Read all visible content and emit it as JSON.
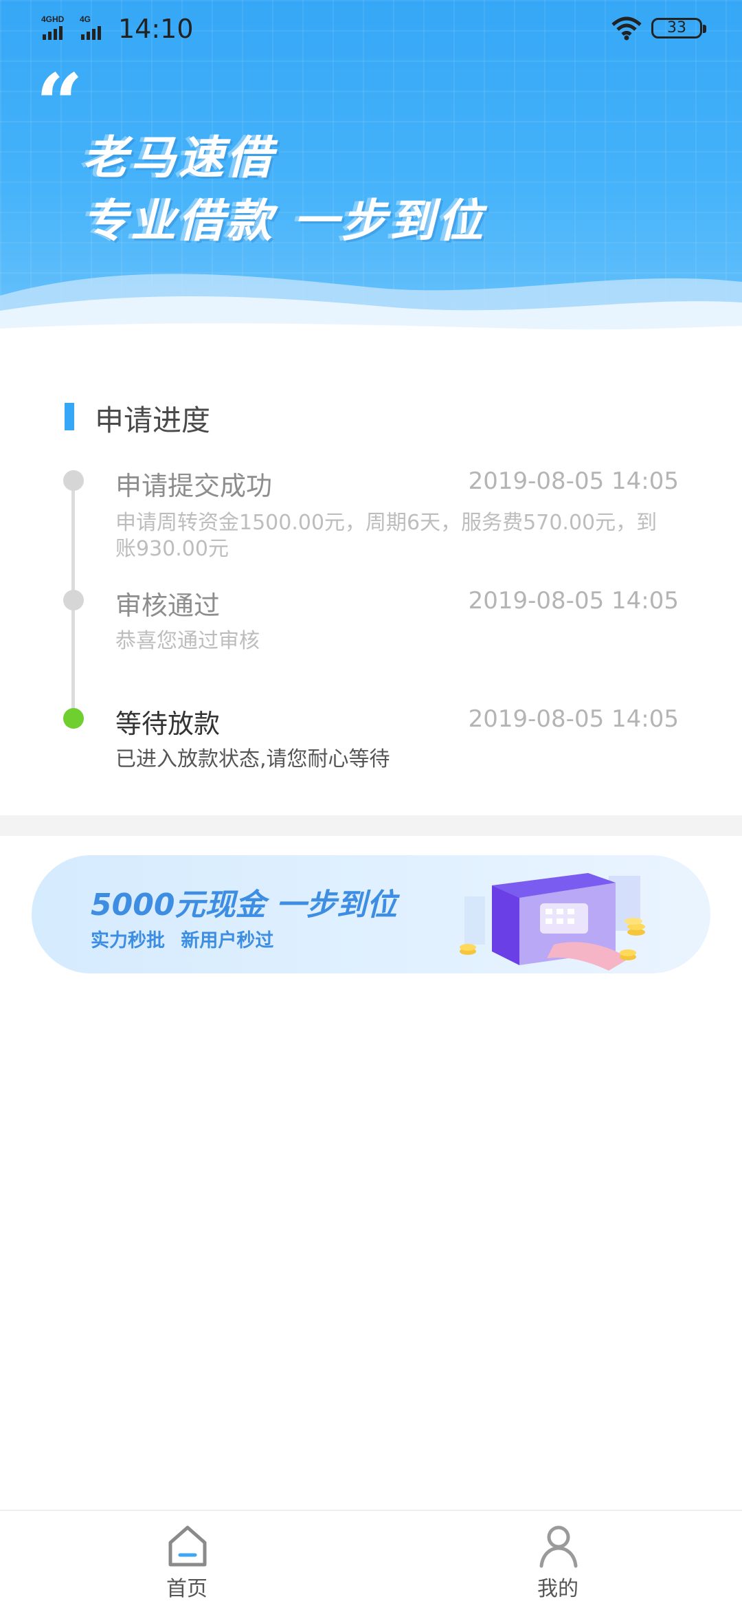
{
  "status_bar": {
    "network": "4GHD 4G",
    "time": "14:10",
    "battery": "33"
  },
  "header": {
    "slogan_line1": "老马速借",
    "slogan_line2": "专业借款 一步到位"
  },
  "progress": {
    "section_title": "申请进度",
    "steps": [
      {
        "title": "申请提交成功",
        "time": "2019-08-05 14:05",
        "desc": "申请周转资金1500.00元，周期6天，服务费570.00元，到账930.00元"
      },
      {
        "title": "审核通过",
        "time": "2019-08-05 14:05",
        "desc": "恭喜您通过审核"
      },
      {
        "title": "等待放款",
        "time": "2019-08-05 14:05",
        "desc": "已进入放款状态,请您耐心等待"
      }
    ]
  },
  "banner": {
    "title": "5000元现金 一步到位",
    "subtitle": "实力秒批 新用户秒过"
  },
  "bottom_nav": {
    "items": [
      {
        "label": "首页",
        "icon": "home-icon"
      },
      {
        "label": "我的",
        "icon": "person-icon"
      }
    ]
  },
  "colors": {
    "brand_blue": "#35a7f6",
    "active_green": "#6fcf2e",
    "banner_text": "#3d8ee3"
  }
}
